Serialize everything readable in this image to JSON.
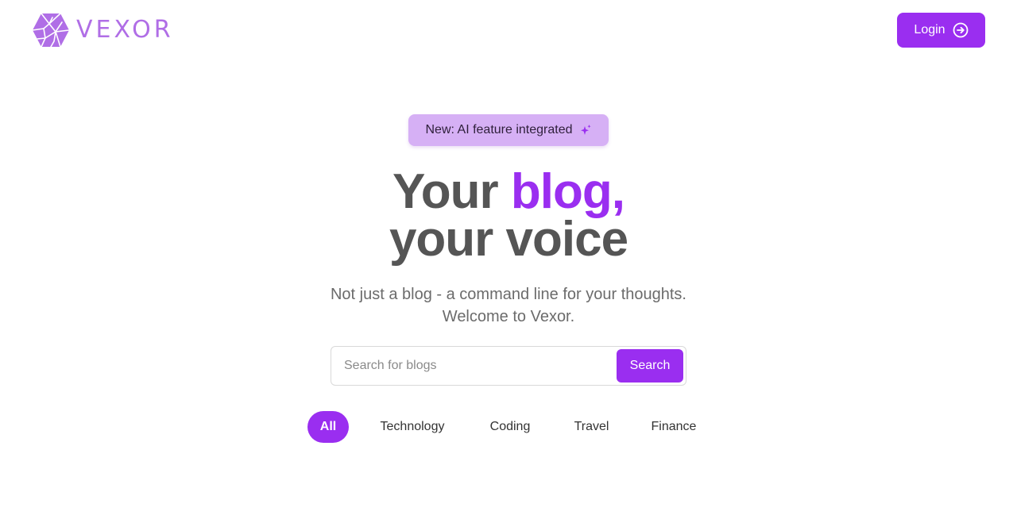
{
  "header": {
    "logo_text": "VEXOR",
    "login_label": "Login"
  },
  "badge": {
    "text": "New: AI feature integrated",
    "icon": "sparkles-icon"
  },
  "hero": {
    "line1_plain": "Your ",
    "line1_accent": "blog,",
    "line2": "your voice"
  },
  "subtitle": {
    "line1": "Not just a blog - a command line for your thoughts.",
    "line2": "Welcome to Vexor."
  },
  "search": {
    "placeholder": "Search for blogs",
    "value": "",
    "button_label": "Search"
  },
  "categories": {
    "items": [
      "All",
      "Technology",
      "Coding",
      "Travel",
      "Finance"
    ],
    "selected": "All"
  },
  "colors": {
    "accent": "#9a2ef0",
    "logo": "#b06ee6",
    "badge_bg": "#d6b0f5",
    "text": "#555555"
  },
  "icons": {
    "logo": "hexagon-mesh-logo",
    "login": "arrow-circle-right-icon",
    "badge": "sparkles-icon"
  }
}
